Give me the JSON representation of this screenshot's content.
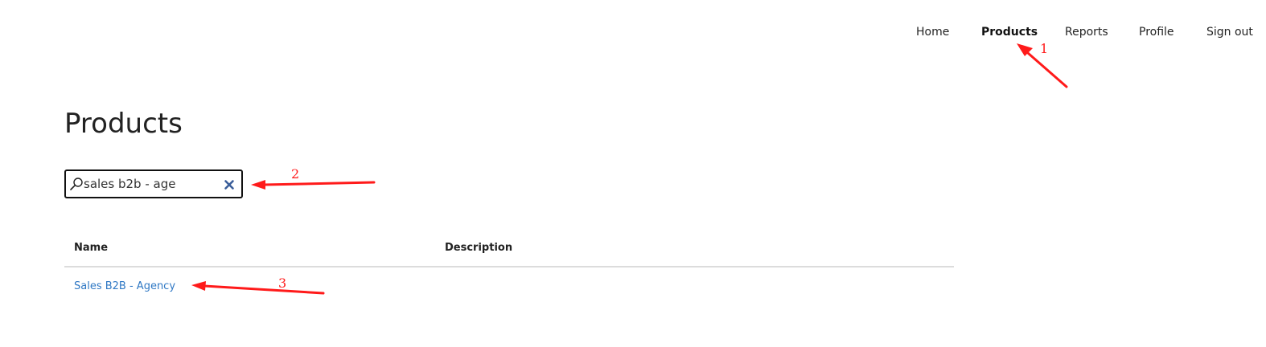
{
  "nav": {
    "items": [
      {
        "label": "Home",
        "active": false
      },
      {
        "label": "Products",
        "active": true
      },
      {
        "label": "Reports",
        "active": false
      },
      {
        "label": "Profile",
        "active": false
      },
      {
        "label": "Sign out",
        "active": false
      }
    ]
  },
  "page": {
    "title": "Products"
  },
  "search": {
    "value": "sales b2b - age",
    "icon": "search-icon",
    "clear_icon": "close-icon"
  },
  "table": {
    "columns": [
      "Name",
      "Description"
    ],
    "rows": [
      {
        "name": "Sales B2B - Agency",
        "description": ""
      }
    ]
  },
  "annotations": {
    "color": "#ff1a1a",
    "labels": [
      "1",
      "2",
      "3"
    ]
  },
  "colors": {
    "link": "#2f78c4",
    "annotation": "#ff1a1a",
    "divider": "#dcdcdc"
  }
}
